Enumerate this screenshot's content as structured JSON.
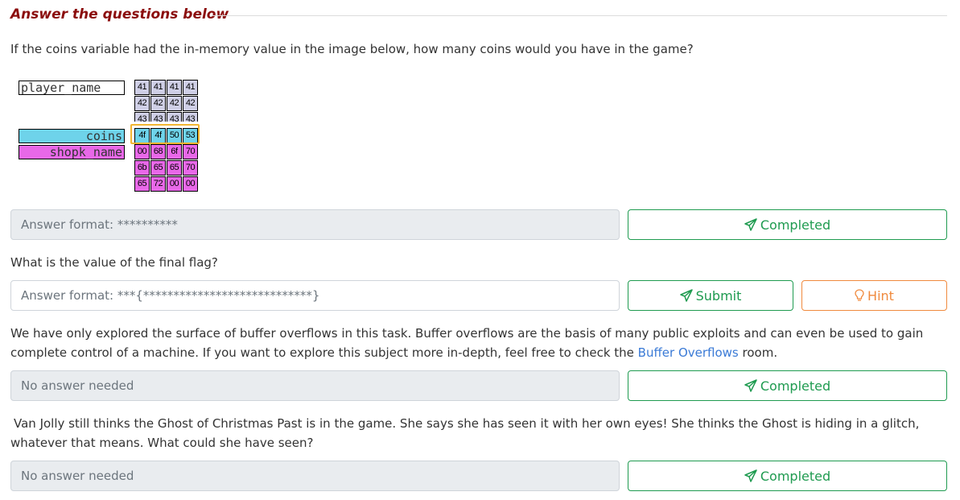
{
  "section": {
    "title": "Answer the questions below"
  },
  "questions": [
    {
      "text": "If the coins variable had the in-memory value in the image below, how many coins would you have in the game?",
      "answer_placeholder": "Answer format: **********",
      "button_label": "Completed"
    },
    {
      "text": "What is the value of the final flag?",
      "answer_placeholder": "Answer format: ***{****************************}",
      "submit_label": "Submit",
      "hint_label": "Hint"
    },
    {
      "text_before_link": "We have only explored the surface of buffer overflows in this task. Buffer overflows are the basis of many public exploits and can even be used to gain complete control of a machine. If you want to explore this subject more in-depth, feel free to check the ",
      "link_text": "Buffer Overflows",
      "text_after_link": " room.",
      "answer_placeholder": "No answer needed",
      "button_label": "Completed"
    },
    {
      "text": "Van Jolly still thinks the Ghost of Christmas Past is in the game. She says she has seen it with her own eyes! She thinks the Ghost is hiding in a glitch, whatever that means. What could she have seen?",
      "answer_placeholder": "No answer needed",
      "button_label": "Completed"
    }
  ],
  "memory_diagram": {
    "labels": {
      "player": "player_name",
      "coins": "coins",
      "shopk": "shopk_name"
    },
    "rows": [
      [
        "41",
        "41",
        "41",
        "41"
      ],
      [
        "42",
        "42",
        "42",
        "42"
      ],
      [
        "43",
        "43",
        "43",
        "43"
      ],
      [
        "4f",
        "4f",
        "50",
        "53"
      ],
      [
        "00",
        "68",
        "6f",
        "70"
      ],
      [
        "6b",
        "65",
        "65",
        "70"
      ],
      [
        "65",
        "72",
        "00",
        "00"
      ]
    ],
    "row_colors": [
      "#cfcfe6",
      "#cfcfe6",
      "#cfcfe6",
      "#6ed3ea",
      "#e868e8",
      "#e868e8",
      "#e868e8"
    ],
    "highlight_color": "#f2b632"
  },
  "colors": {
    "title": "#8b0d0d",
    "success": "#1f9b50",
    "hint": "#f08a3e",
    "link": "#3a7ad6",
    "readonly_bg": "#e9ecef"
  },
  "icons": {
    "completed": "paper-plane-icon",
    "submit": "paper-plane-icon",
    "hint": "lightbulb-icon"
  }
}
